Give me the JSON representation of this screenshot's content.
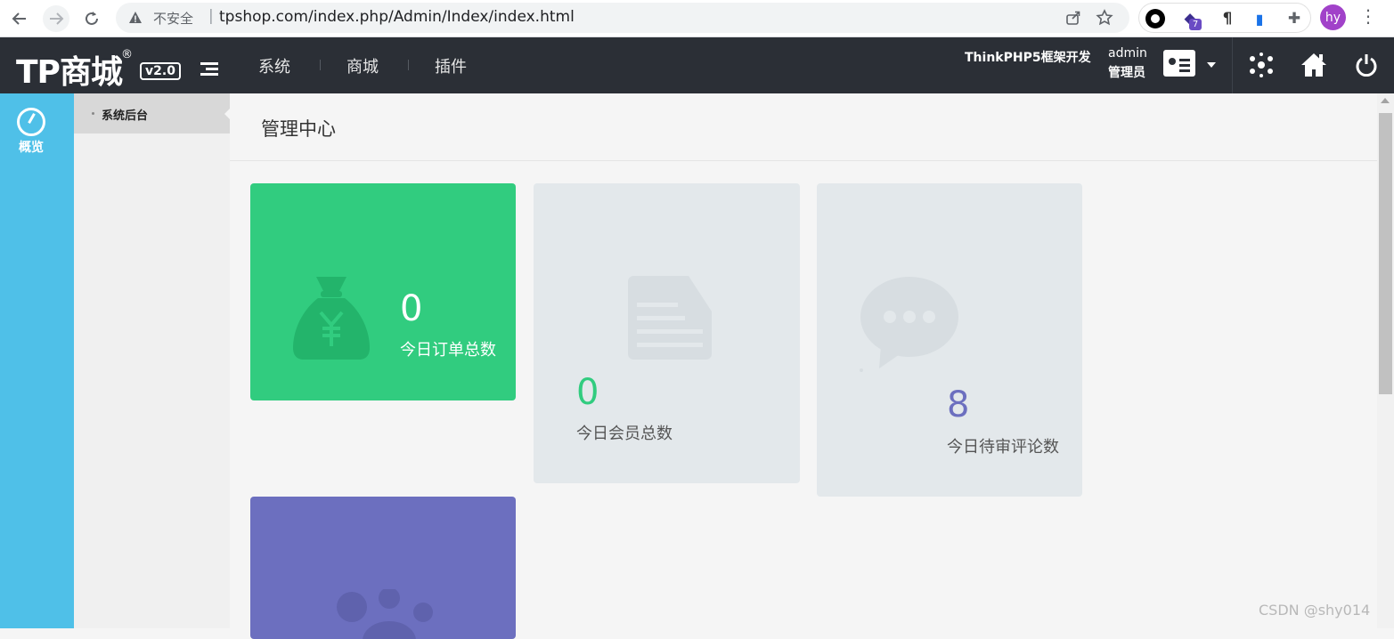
{
  "browser": {
    "security_label": "不安全",
    "separator": "|",
    "url": "tpshop.com/index.php/Admin/Index/index.html",
    "extension_badge": "7",
    "avatar_initials": "hy",
    "avatar_color": "#a142c9"
  },
  "header": {
    "logo_text": "TP商城",
    "logo_mark": "®",
    "version": "v2.0",
    "nav": [
      {
        "label": "系统"
      },
      {
        "label": "商城"
      },
      {
        "label": "插件"
      }
    ],
    "framework_label": "ThinkPHP5框架开发",
    "user_name": "admin",
    "user_role": "管理员",
    "background_color": "#2b2f36"
  },
  "left_bar": {
    "overview_label": "概览",
    "color": "#4fc0e8"
  },
  "sub_menu": {
    "items": [
      {
        "label": "系统后台",
        "active": true
      }
    ]
  },
  "main": {
    "title": "管理中心",
    "tiles": [
      {
        "icon": "money-bag-icon",
        "value": "0",
        "label": "今日订单总数",
        "color": "#31cc7f"
      },
      {
        "icon": "document-icon",
        "value": "0",
        "label": "今日会员总数",
        "color": "#e3e8eb",
        "value_color": "#31cc7f"
      },
      {
        "icon": "chat-bubble-icon",
        "value": "8",
        "label": "今日待审评论数",
        "color": "#e3e8eb",
        "value_color": "#6c6fbf"
      },
      {
        "icon": "paw-icon",
        "value": "",
        "label": "",
        "color": "#6c6fbf"
      }
    ]
  },
  "watermark": "CSDN @shy014"
}
